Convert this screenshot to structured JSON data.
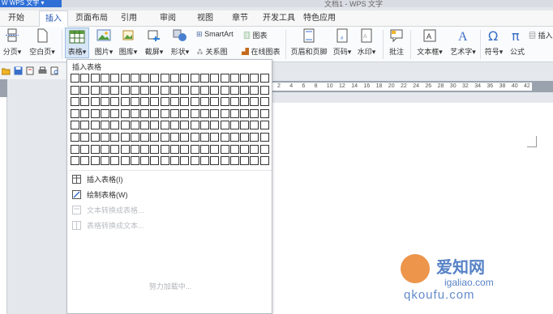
{
  "titlebar": {
    "app_name": "WPS 文字",
    "doc_title": "文档1 - WPS 文字"
  },
  "tabs": [
    {
      "label": "开始"
    },
    {
      "label": "插入"
    },
    {
      "label": "页面布局"
    },
    {
      "label": "引用"
    },
    {
      "label": "审阅"
    },
    {
      "label": "视图"
    },
    {
      "label": "章节"
    },
    {
      "label": "开发工具"
    },
    {
      "label": "特色应用"
    }
  ],
  "active_tab": "插入",
  "ribbon": {
    "page_break": "分页",
    "blank_page": "空白页",
    "table": "表格",
    "picture": "图片",
    "gallery": "图库",
    "screenshot": "截屏",
    "shape": "形状",
    "smartart": "SmartArt",
    "chart": "图表",
    "relation": "关系图",
    "online_chart": "在线图表",
    "header_footer": "页眉和页脚",
    "page_number": "页码",
    "watermark": "水印",
    "comment": "批注",
    "textbox": "文本框",
    "wordart": "艺术字",
    "symbol": "符号",
    "formula": "公式",
    "insert_more": "插入"
  },
  "ruler_numbers": [
    "2",
    "4",
    "6",
    "8",
    "10",
    "12",
    "14",
    "16",
    "18",
    "20",
    "22",
    "24",
    "26",
    "28",
    "30",
    "32",
    "34",
    "36",
    "38",
    "40",
    "42"
  ],
  "dropdown": {
    "title": "插入表格",
    "grid_cols": 20,
    "grid_rows": 8,
    "items": [
      {
        "label": "插入表格(I)",
        "enabled": true
      },
      {
        "label": "绘制表格(W)",
        "enabled": true
      },
      {
        "label": "文本转换成表格...",
        "enabled": false
      },
      {
        "label": "表格转换成文本...",
        "enabled": false
      }
    ],
    "loading": "努力加载中..."
  },
  "watermark": {
    "line1": "爱知网",
    "line2": "igaliao.com",
    "line3": "qkoufu.com"
  },
  "colors": {
    "accent": "#2f6fd6",
    "tab_active_text": "#2a59b6",
    "selected_bg": "#d7e6f7"
  }
}
